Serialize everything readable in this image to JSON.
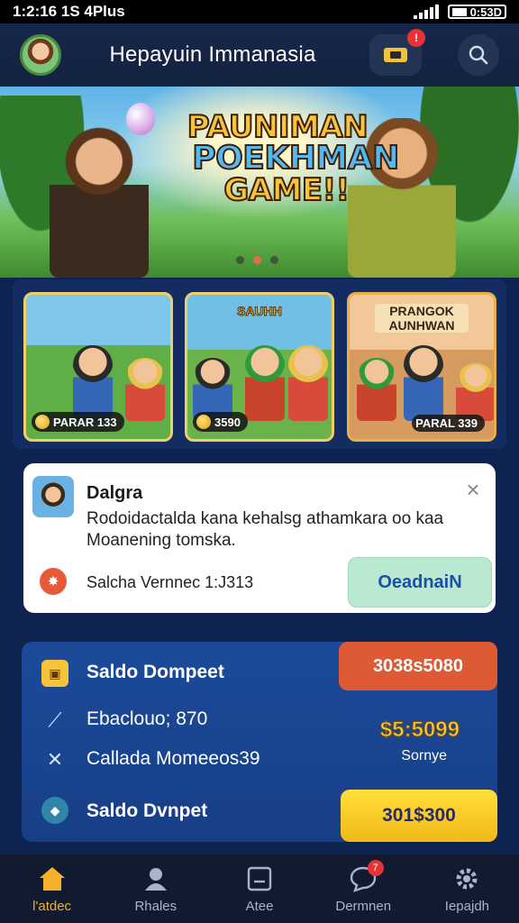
{
  "status_bar": {
    "time": "1:2:16 1S 4Plus",
    "battery": "0:53D"
  },
  "header": {
    "title": "Hepayuin Immanasia",
    "notif_count": "!"
  },
  "banner": {
    "title_line1": "PAUNIMAN",
    "title_line2": "POEKHMAN",
    "title_line3": "GAME!!",
    "dots": 3,
    "active_dot": 1
  },
  "cards": [
    {
      "title": "",
      "label": "PARAR 133"
    },
    {
      "title": "SAUHH",
      "label": "3590"
    },
    {
      "title": "PRANGOK AUNHWAN",
      "label": "PARAL 339"
    }
  ],
  "popup": {
    "title": "Dalgra",
    "body": "Rodoidactalda kana kehalsg athamkara oo kaa Moanening tomska.",
    "footer_text": "Salcha Vernnec 1:J313",
    "action_label": "OeadnaiN"
  },
  "wallet": {
    "title": "Saldo Dompeet",
    "row1": "Ebaclouo; 870",
    "row2": "Callada Momeeos39",
    "row3": "Saldo Dvnpet",
    "top_button": "3038s5080",
    "amount": "$5:5099",
    "amount_label": "Sornye",
    "bottom_button": "301$300"
  },
  "nav": {
    "items": [
      {
        "label": "l'atdec",
        "icon": "home-icon"
      },
      {
        "label": "Rhales",
        "icon": "user-icon"
      },
      {
        "label": "Atee",
        "icon": "card-icon"
      },
      {
        "label": "Dermnen",
        "icon": "chat-icon",
        "badge": "7"
      },
      {
        "label": "Iepajdh",
        "icon": "gear-icon"
      }
    ],
    "active_index": 0
  },
  "colors": {
    "accent": "#f6b12a",
    "popup_action_bg": "#b9e9d0",
    "wallet_top_button": "#dd5a34",
    "wallet_bottom_button": "#ffd52a"
  }
}
